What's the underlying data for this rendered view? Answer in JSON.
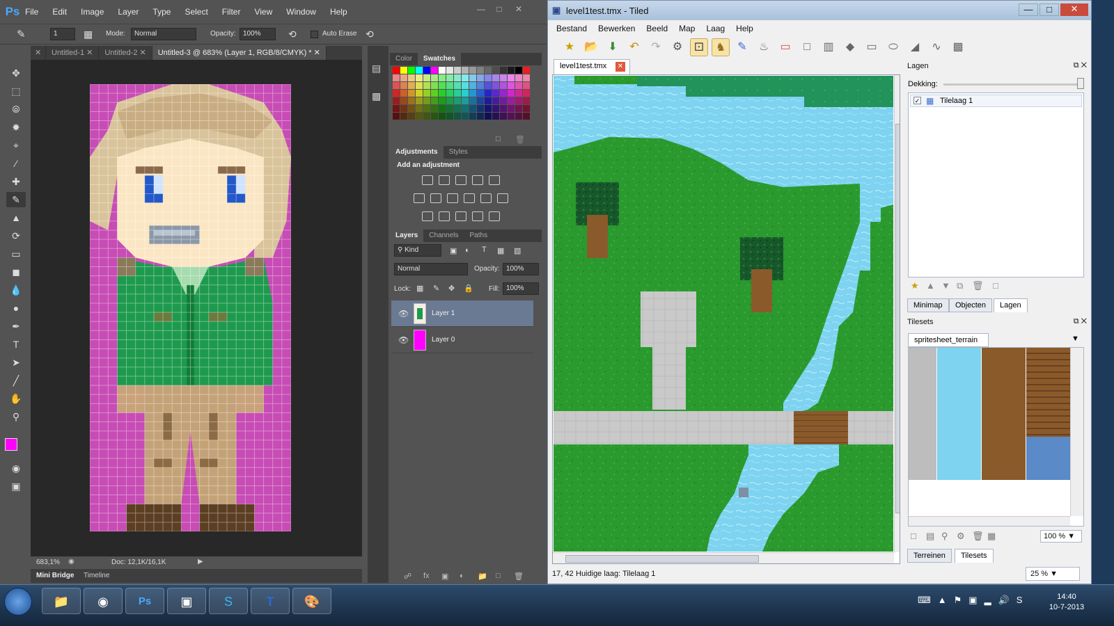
{
  "ps": {
    "logo": "Ps",
    "menu": [
      "File",
      "Edit",
      "Image",
      "Layer",
      "Type",
      "Select",
      "Filter",
      "View",
      "Window",
      "Help"
    ],
    "options": {
      "brush_size": "1",
      "mode_label": "Mode:",
      "mode_value": "Normal",
      "opacity_label": "Opacity:",
      "opacity_value": "100%",
      "auto_erase": "Auto Erase"
    },
    "tabs": [
      "Untitled-1",
      "Untitled-2",
      "Untitled-3 @ 683% (Layer 1, RGB/8/CMYK) *"
    ],
    "status": {
      "zoom": "683,1%",
      "doc": "Doc: 12,1K/16,1K"
    },
    "bottom_tabs": [
      "Mini Bridge",
      "Timeline"
    ],
    "color_panel": {
      "tabs": [
        "Color",
        "Swatches"
      ]
    },
    "adjustments": {
      "tabs": [
        "Adjustments",
        "Styles"
      ],
      "heading": "Add an adjustment"
    },
    "layers_panel": {
      "tabs": [
        "Layers",
        "Channels",
        "Paths"
      ],
      "kind": "Kind",
      "blend": "Normal",
      "opacity_label": "Opacity:",
      "opacity_value": "100%",
      "lock_label": "Lock:",
      "fill_label": "Fill:",
      "fill_value": "100%",
      "layers": [
        {
          "name": "Layer 1",
          "selected": true
        },
        {
          "name": "Layer 0",
          "selected": false
        }
      ]
    },
    "colors": {
      "foreground": "#ff00ff",
      "background": "#1a8a3a",
      "canvas_bg": "#c74cb5"
    }
  },
  "tiled": {
    "title": "level1test.tmx - Tiled",
    "menu": [
      "Bestand",
      "Bewerken",
      "Beeld",
      "Map",
      "Laag",
      "Help"
    ],
    "map_tab": "level1test.tmx",
    "status": {
      "coords": "17, 42",
      "current_layer": "Huidige laag: Tilelaag 1",
      "zoom": "25 %"
    },
    "layers_dock": {
      "title": "Lagen",
      "opacity_label": "Dekking:",
      "layers": [
        "Tilelaag 1"
      ],
      "tabs": [
        "Minimap",
        "Objecten",
        "Lagen"
      ]
    },
    "tilesets_dock": {
      "title": "Tilesets",
      "tileset_name": "spritesheet_terrain",
      "zoom": "100 %",
      "tabs": [
        "Terreinen",
        "Tilesets"
      ]
    }
  },
  "taskbar": {
    "time": "14:40",
    "date": "10-7-2013"
  }
}
